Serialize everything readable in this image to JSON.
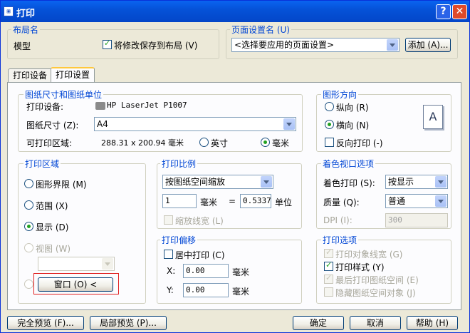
{
  "window": {
    "title": "打印",
    "app_icon": "autocad-icon"
  },
  "layout": {
    "legend": "布局名",
    "name": "模型",
    "save_changes_label": "将修改保存到布局 (V)",
    "save_changes_checked": true
  },
  "page_setup": {
    "legend": "页面设置名 (U)",
    "selected": "<选择要应用的页面设置>",
    "add_button": "添加 (A)..."
  },
  "tabs": [
    {
      "label": "打印设备"
    },
    {
      "label": "打印设置"
    }
  ],
  "paper": {
    "legend": "图纸尺寸和图纸单位",
    "device_label": "打印设备:",
    "device_value": "HP LaserJet P1007",
    "size_label": "图纸尺寸 (Z):",
    "size_value": "A4",
    "printable_label": "可打印区域:",
    "printable_value": "288.31 x 200.94 毫米",
    "inches_label": "英寸",
    "mm_label": "毫米",
    "units_selected": "毫米"
  },
  "orientation": {
    "legend": "图形方向",
    "portrait": "纵向 (R)",
    "landscape": "横向 (N)",
    "reverse": "反向打印 (-)",
    "selected": "landscape",
    "icon_letter": "A"
  },
  "print_area": {
    "legend": "打印区域",
    "limits": "图形界限 (M)",
    "extents": "范围 (X)",
    "display": "显示 (D)",
    "view": "视图 (W)",
    "window_button": "窗口 (O) <",
    "selected": "display"
  },
  "scale": {
    "legend": "打印比例",
    "mode": "按图纸空间缩放",
    "num": "1",
    "unit": "毫米",
    "equals": "=",
    "den": "0.5337",
    "den_unit": "单位",
    "scale_lineweights": "缩放线宽 (L)"
  },
  "offset": {
    "legend": "打印偏移",
    "center": "居中打印 (C)",
    "x_label": "X:",
    "x_value": "0.00",
    "y_label": "Y:",
    "y_value": "0.00",
    "unit": "毫米"
  },
  "shade": {
    "legend": "着色视口选项",
    "shade_label": "着色打印 (S):",
    "shade_value": "按显示",
    "quality_label": "质量 (Q):",
    "quality_value": "普通",
    "dpi_label": "DPI (I):",
    "dpi_value": "300"
  },
  "options": {
    "legend": "打印选项",
    "obj_lineweights": "打印对象线宽 (G)",
    "plot_styles": "打印样式 (Y)",
    "paperspace_last": "最后打印图纸空间 (E)",
    "hide_objects": "隐藏图纸空间对象 (J)"
  },
  "footer": {
    "full_preview": "完全预览 (F)...",
    "partial_preview": "局部预览 (P)...",
    "ok": "确定",
    "cancel": "取消",
    "help": "帮助 (H)"
  }
}
